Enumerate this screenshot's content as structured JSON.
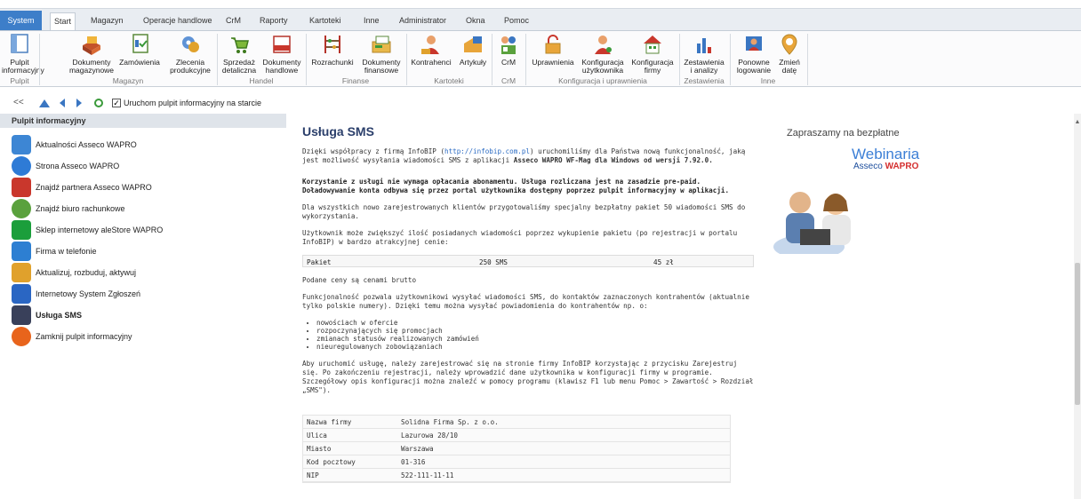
{
  "menu": {
    "tabs": [
      "System",
      "Start",
      "Magazyn",
      "Operacje handlowe",
      "CrM",
      "Raporty",
      "Kartoteki",
      "Inne",
      "Administrator",
      "Okna",
      "Pomoc"
    ]
  },
  "ribbon": {
    "buttons": [
      {
        "line1": "Pulpit",
        "line2": "informacyjny",
        "icon": "monitor-icon"
      },
      {
        "line1": "Dokumenty",
        "line2": "magazynowe",
        "icon": "documents-box-icon"
      },
      {
        "line1": "Zamówienia",
        "line2": "",
        "icon": "order-icon"
      },
      {
        "line1": "Zlecenia",
        "line2": "produkcyjne",
        "icon": "production-icon"
      },
      {
        "line1": "Sprzedaż",
        "line2": "detaliczna",
        "icon": "cart-icon"
      },
      {
        "line1": "Dokumenty",
        "line2": "handlowe",
        "icon": "invoice-icon"
      },
      {
        "line1": "Rozrachunki",
        "line2": "",
        "icon": "abacus-icon"
      },
      {
        "line1": "Dokumenty",
        "line2": "finansowe",
        "icon": "finance-icon"
      },
      {
        "line1": "Kontrahenci",
        "line2": "",
        "icon": "contractors-icon"
      },
      {
        "line1": "Artykuły",
        "line2": "",
        "icon": "articles-icon"
      },
      {
        "line1": "CrM",
        "line2": "",
        "icon": "crm-icon"
      },
      {
        "line1": "Uprawnienia",
        "line2": "",
        "icon": "permissions-icon"
      },
      {
        "line1": "Konfiguracja",
        "line2": "użytkownika",
        "icon": "user-config-icon"
      },
      {
        "line1": "Konfiguracja",
        "line2": "firmy",
        "icon": "company-config-icon"
      },
      {
        "line1": "Zestawienia",
        "line2": "i analizy",
        "icon": "chart-icon"
      },
      {
        "line1": "Ponowne",
        "line2": "logowanie",
        "icon": "relogin-icon"
      },
      {
        "line1": "Zmień",
        "line2": "datę",
        "icon": "change-date-icon"
      }
    ],
    "groups": [
      "Pulpit",
      "Magazyn",
      "Handel",
      "Finanse",
      "Kartoteki",
      "CrM",
      "Konfiguracja i uprawnienia",
      "Zestawienia",
      "Inne"
    ]
  },
  "toolbar": {
    "back": "<<",
    "startup_label": "Uruchom pulpit informacyjny na starcie",
    "startup_checked": "✓"
  },
  "sidebar": {
    "header": "Pulpit informacyjny",
    "items": [
      {
        "label": "Aktualności Asseco WAPRO",
        "icon": "news-icon",
        "color": "#3d86d4"
      },
      {
        "label": "Strona Asseco WAPRO",
        "icon": "globe-icon",
        "color": "#2e7bd6"
      },
      {
        "label": "Znajdź partnera Asseco WAPRO",
        "icon": "partner-icon",
        "color": "#c9372c"
      },
      {
        "label": "Znajdź biuro rachunkowe",
        "icon": "office-search-icon",
        "color": "#5aa13d"
      },
      {
        "label": "Sklep internetowy aleStore WAPRO",
        "icon": "shop-icon",
        "color": "#1b9e3b"
      },
      {
        "label": "Firma w telefonie",
        "icon": "phone-check-icon",
        "color": "#2d7fd2"
      },
      {
        "label": "Aktualizuj, rozbuduj, aktywuj",
        "icon": "update-icon",
        "color": "#e0a12c"
      },
      {
        "label": "Internetowy System Zgłoszeń",
        "icon": "support-icon",
        "color": "#2a66c3"
      },
      {
        "label": "Usługa SMS",
        "icon": "sms-phone-icon",
        "color": "#39405a"
      },
      {
        "label": "Zamknij pulpit informacyjny",
        "icon": "power-icon",
        "color": "#e8641c"
      }
    ]
  },
  "content": {
    "title": "Usługa SMS",
    "intro_1": "Dzięki współpracy z firmą InfoBIP (",
    "intro_link": "http://infobip.com.pl",
    "intro_2": ") uruchomiliśmy dla Państwa nową funkcjonalność, jaką jest możliwość wysyłania wiadomości SMS z aplikacji ",
    "intro_bold": "Asseco WAPRO WF-Mag dla Windows od wersji 7.92.0.",
    "billing": "Korzystanie z usługi nie wymaga opłacania abonamentu. Usługa rozliczana jest na zasadzie pre-paid. Doładowywanie konta odbywa się przez portal użytkownika dostępny poprzez pulpit informacyjny w aplikacji.",
    "free_pack": "Dla wszystkich nowo zarejestrowanych klientów przygotowaliśmy specjalny bezpłatny pakiet 50 wiadomości SMS do wykorzystania.",
    "buy_more": "Użytkownik może zwiększyć ilość posiadanych wiadomości poprzez wykupienie pakietu (po rejestracji w portalu InfoBIP) w bardzo atrakcyjnej cenie:",
    "price": {
      "col1": "Pakiet",
      "col2": "250 SMS",
      "col3": "45 zł"
    },
    "gross": "Podane ceny są cenami brutto",
    "functionality": "Funkcjonalność pozwala użytkownikowi wysyłać wiadomości SMS, do kontaktów zaznaczonych kontrahentów (aktualnie tylko polskie numery). Dzięki temu można wysyłać powiadomienia do kontrahentów np. o:",
    "bullets": [
      "nowościach w ofercie",
      "rozpoczynających się promocjach",
      "zmianach statusów realizowanych zamówień",
      "nieuregulowanych zobowiązaniach"
    ],
    "activation": "Aby uruchomić usługę, należy zarejestrować się na stronie firmy InfoBIP korzystając z przycisku Zarejestruj się. Po zakończeniu rejestracji, należy wprowadzić dane użytkownika w konfiguracji firmy w programie. Szczegółowy opis konfiguracji można znaleźć w pomocy programu (klawisz F1 lub menu Pomoc > Zawartość > Rozdział „SMS\").",
    "firm": [
      {
        "key": "Nazwa firmy",
        "value": "Solidna Firma Sp. z o.o."
      },
      {
        "key": "Ulica",
        "value": "Lazurowa 28/10"
      },
      {
        "key": "Miasto",
        "value": "Warszawa"
      },
      {
        "key": "Kod pocztowy",
        "value": "01-316"
      },
      {
        "key": "NIP",
        "value": "522-111-11-11"
      }
    ]
  },
  "banner": {
    "line1": "Zapraszamy na bezpłatne",
    "line2": "Webinaria",
    "line3a": "Asseco ",
    "line3b": "WAPRO"
  }
}
